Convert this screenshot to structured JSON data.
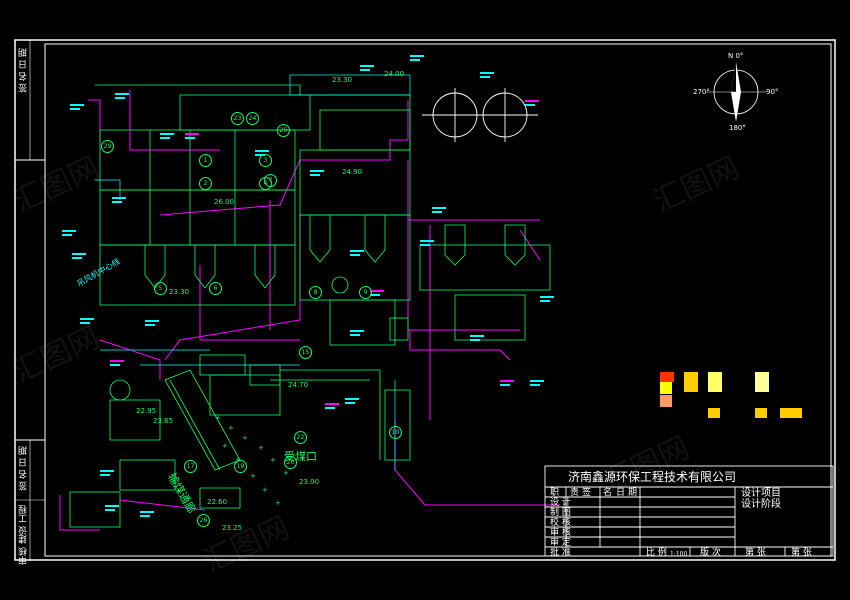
{
  "colors": {
    "background": "#000000",
    "frame": "#ffffff",
    "equipment": "#00ff66",
    "annotation": "#00ffff",
    "pipe": "#ff00ff",
    "accent": "#ffff00"
  },
  "compass": {
    "north": "N 0°",
    "east": "90°",
    "south": "180°",
    "west": "270°"
  },
  "left_strip": {
    "top_text": "签 名 日 期",
    "bottom_text": "签 名 日 期",
    "side_text": "审核 建设 工程"
  },
  "title_block": {
    "company": "济南鑫源环保工程技术有限公司",
    "col_headers": [
      "职",
      "责",
      "签",
      "名",
      "日",
      "期"
    ],
    "rows": [
      "设 计",
      "制 图",
      "校 核",
      "审 核",
      "审 定",
      "批 准"
    ],
    "project_label": "设计项目",
    "stage_label": "设计阶段",
    "scale_label": "比 例",
    "scale_value": "1:100",
    "version_label": "版 次",
    "sheet_label": "第   张",
    "sheet_total_label": "第   张"
  },
  "plan": {
    "area_labels": [
      "输煤通廊",
      "受煤口",
      "吊风机中心线"
    ],
    "circled_numbers": [
      "1",
      "2",
      "3",
      "4",
      "5",
      "6",
      "7",
      "8",
      "9",
      "10",
      "15",
      "17",
      "19",
      "20",
      "22",
      "23",
      "24",
      "25",
      "26",
      "29"
    ],
    "elevations": [
      "23.30",
      "24.00",
      "26.00",
      "24.90",
      "23.30",
      "24.70",
      "22.95",
      "23.65",
      "23.00",
      "22.60",
      "23.25"
    ]
  }
}
